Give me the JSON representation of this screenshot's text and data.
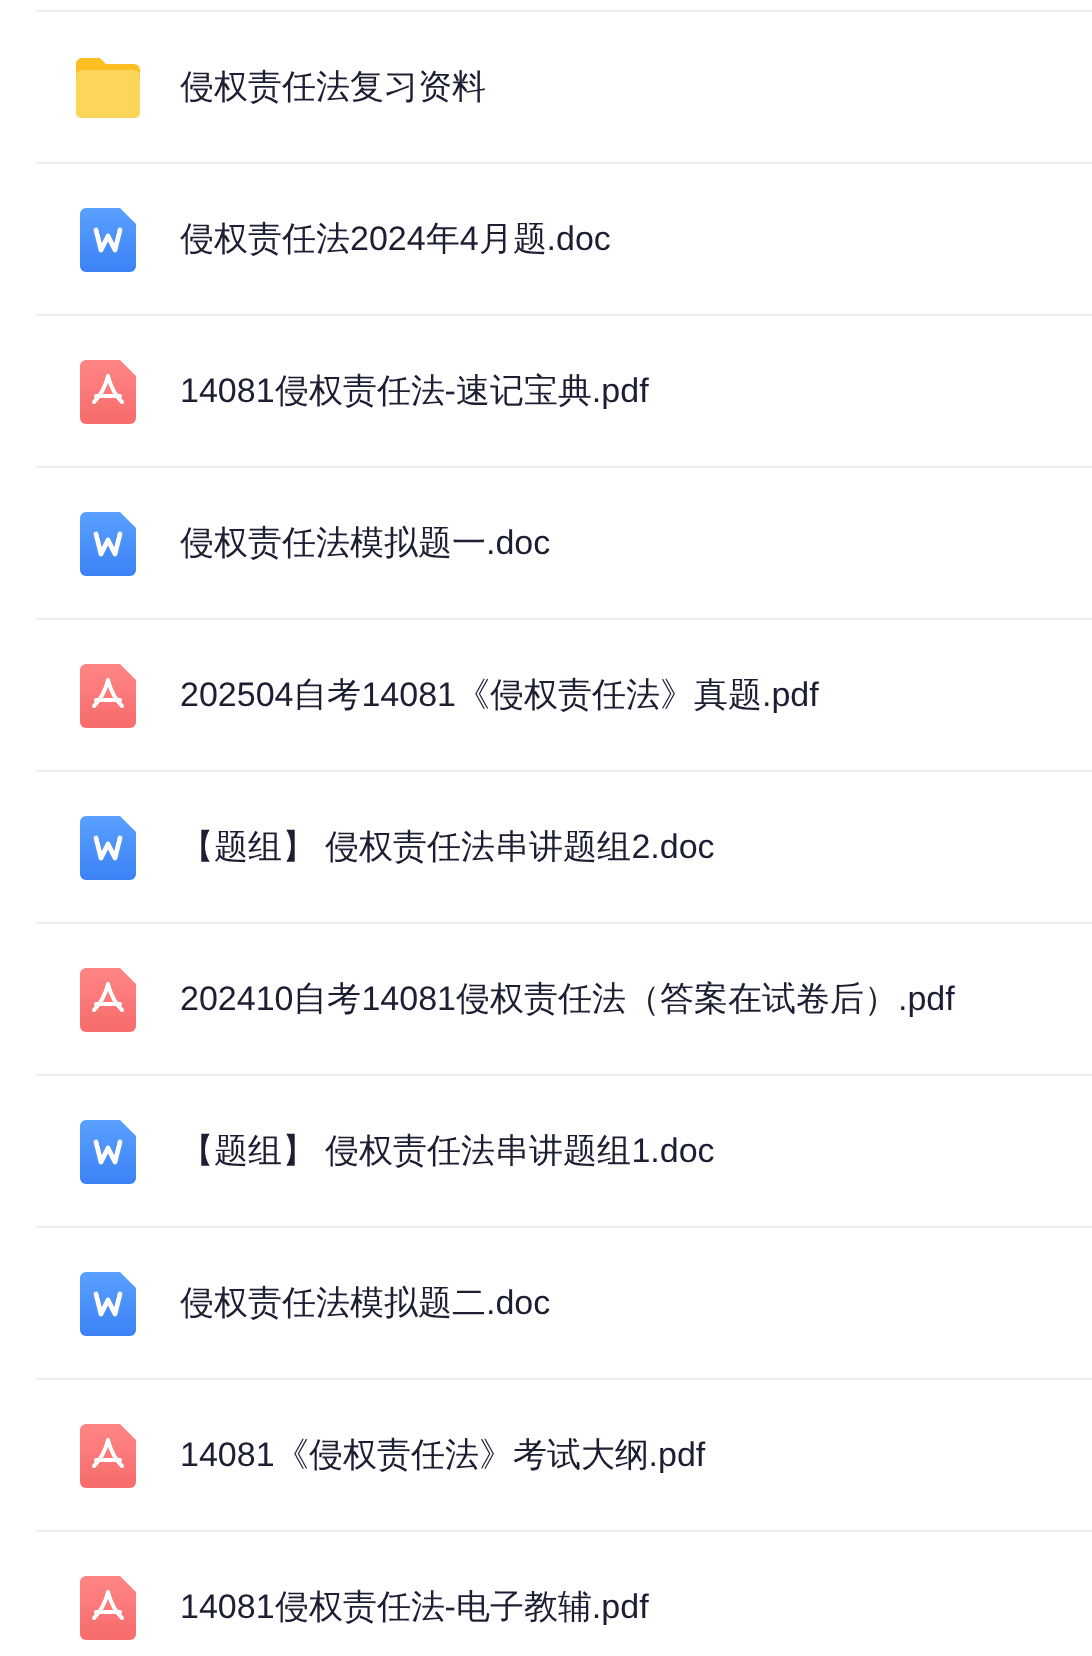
{
  "files": [
    {
      "kind": "folder",
      "name": "侵权责任法复习资料"
    },
    {
      "kind": "doc",
      "name": "侵权责任法2024年4月题.doc"
    },
    {
      "kind": "pdf",
      "name": "14081侵权责任法-速记宝典.pdf"
    },
    {
      "kind": "doc",
      "name": "侵权责任法模拟题一.doc"
    },
    {
      "kind": "pdf",
      "name": "202504自考14081《侵权责任法》真题.pdf"
    },
    {
      "kind": "doc",
      "name": "【题组】 侵权责任法串讲题组2.doc"
    },
    {
      "kind": "pdf",
      "name": "202410自考14081侵权责任法（答案在试卷后）.pdf"
    },
    {
      "kind": "doc",
      "name": "【题组】 侵权责任法串讲题组1.doc"
    },
    {
      "kind": "doc",
      "name": "侵权责任法模拟题二.doc"
    },
    {
      "kind": "pdf",
      "name": "14081《侵权责任法》考试大纲.pdf"
    },
    {
      "kind": "pdf",
      "name": "14081侵权责任法-电子教辅.pdf"
    }
  ]
}
